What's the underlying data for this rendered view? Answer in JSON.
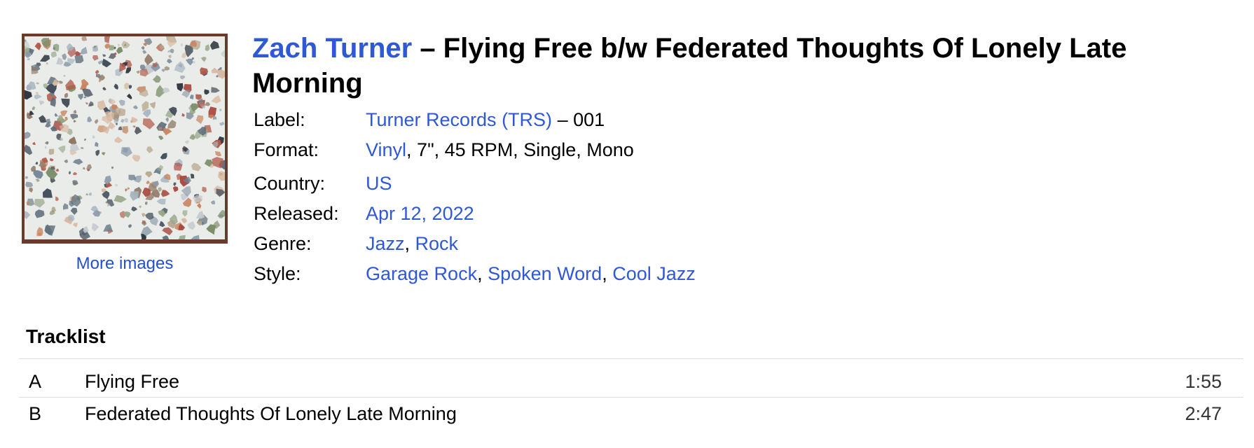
{
  "release": {
    "artist": "Zach Turner",
    "title_rest": "– Flying Free b/w Federated Thoughts Of Lonely Late Morning",
    "more_images": "More images"
  },
  "info": {
    "label": {
      "key": "Label:",
      "link": "Turner Records (TRS)",
      "suffix": "– 001"
    },
    "format": {
      "key": "Format:",
      "link": "Vinyl",
      "suffix": ", 7\", 45 RPM, Single, Mono"
    },
    "country": {
      "key": "Country:",
      "link": "US"
    },
    "released": {
      "key": "Released:",
      "link": "Apr 12, 2022"
    },
    "genre": {
      "key": "Genre:",
      "links": [
        "Jazz",
        "Rock"
      ],
      "sep": ", "
    },
    "style": {
      "key": "Style:",
      "links": [
        "Garage Rock",
        "Spoken Word",
        "Cool Jazz"
      ],
      "sep": ", "
    }
  },
  "tracklist": {
    "heading": "Tracklist",
    "tracks": [
      {
        "position": "A",
        "title": "Flying Free",
        "duration": "1:55"
      },
      {
        "position": "B",
        "title": "Federated Thoughts Of Lonely Late Morning",
        "duration": "2:47"
      }
    ]
  },
  "colors": {
    "link": "#2f58d6",
    "divider": "#dcdcdc",
    "cover_border": "#6a3a2a"
  }
}
